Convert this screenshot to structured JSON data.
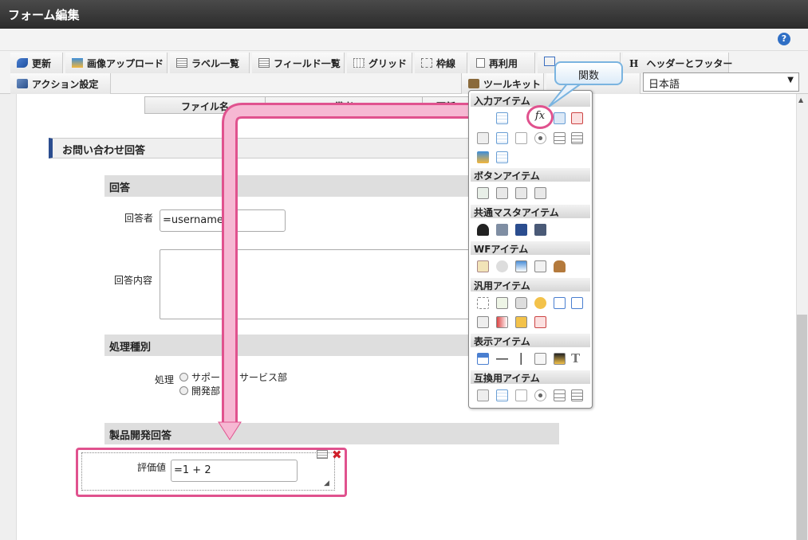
{
  "title": "フォーム編集",
  "help_icon": "?",
  "toolbar": {
    "update": "更新",
    "image_upload": "画像アップロード",
    "label_list": "ラベル一覧",
    "field_list": "フィールド一覧",
    "grid": "グリッド",
    "border": "枠線",
    "reuse": "再利用",
    "header_footer": "ヘッダーとフッター",
    "action_settings": "アクション設定",
    "toolkit": "ツールキット",
    "header_footer_letter": "H"
  },
  "language": "日本語",
  "file_table": {
    "col_filename": "ファイル名",
    "col_notes": "備考",
    "col_updated": "更新"
  },
  "form": {
    "section_title": "お問い合わせ回答",
    "answer_head": "回答",
    "respondent_label": "回答者",
    "respondent_value": "=username()",
    "content_label": "回答内容",
    "process_head": "処理種別",
    "process_label": "処理",
    "radio_support": "サポート・サービス部",
    "radio_dev": "開発部",
    "dev_head": "製品開発回答",
    "eval_label": "評価値",
    "eval_value": "=1 + 2"
  },
  "palette": {
    "input_items": "入力アイテム",
    "button_items": "ボタンアイテム",
    "master_items": "共通マスタアイテム",
    "wf_items": "WFアイテム",
    "general_items": "汎用アイテム",
    "display_items": "表示アイテム",
    "compat_items": "互換用アイテム",
    "fx_label": "fx"
  },
  "callout": "関数",
  "colors": {
    "accent_pink": "#e0528e",
    "callout_blue": "#7ab4e0",
    "section_bar": "#2b4d8f"
  }
}
